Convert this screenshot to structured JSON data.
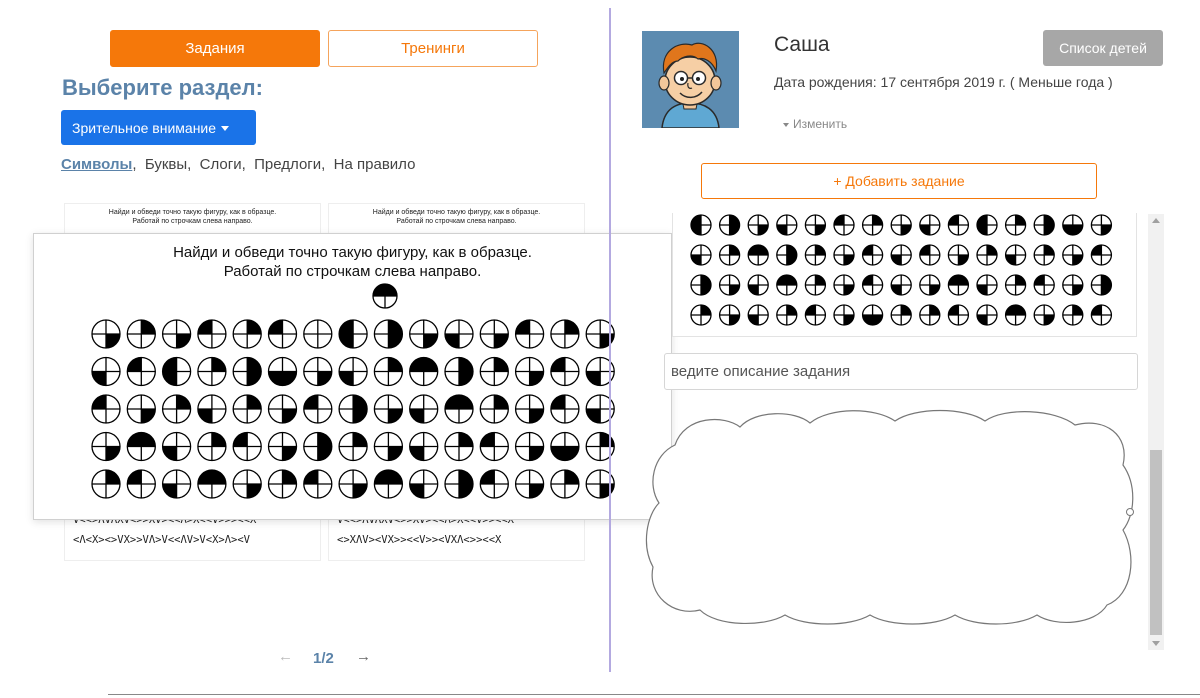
{
  "tabs": {
    "tasks": "Задания",
    "trainings": "Тренинги"
  },
  "section": {
    "title": "Выберите раздел:",
    "dropdown_value": "Зрительное внимание"
  },
  "subnav": {
    "items": [
      "Символы",
      "Буквы",
      "Слоги",
      "Предлоги",
      "На правило"
    ],
    "separator": ","
  },
  "thumbnails": [
    {
      "instruction_line1": "Найди и обведи точно такую фигуру, как в образце.",
      "instruction_line2": "Работай по строчкам слева направо.",
      "row1": "V<<>ΛVΛXV<>>XV><<Λ>X<<V>>><<X",
      "row2": "<Λ<X><>VX>>VΛ>V<<ΛV>V<X>Λ><V"
    },
    {
      "instruction_line1": "Найди и обведи точно такую фигуру, как в образце.",
      "instruction_line2": "Работай по строчкам слева направо.",
      "row1": "V<<>ΛVΛXV<>>XV><<Λ>X<<V>><<X",
      "row2": "<>XΛV><VX>><<V>><VXΛ<>><<X"
    }
  ],
  "preview": {
    "line1": "Найди и обведи точно такую фигуру, как в образце.",
    "line2": "Работай по строчкам слева направо."
  },
  "pagination": {
    "prev": "←",
    "current": "1/2",
    "next": "→"
  },
  "child": {
    "name": "Саша",
    "birth": "Дата рождения: 17 сентября 2019 г. ( Меньше года )",
    "edit": "Изменить"
  },
  "buttons": {
    "children_list": "Список детей",
    "add_task": "+ Добавить задание"
  },
  "description": {
    "placeholder": "Введите описание задания",
    "visible_text": "ведите описание задания"
  },
  "colors": {
    "accent_orange": "#f5780a",
    "dropdown_blue": "#1a73e8",
    "title_blue": "#5b83a9",
    "divider_purple": "#b3a9e0"
  }
}
